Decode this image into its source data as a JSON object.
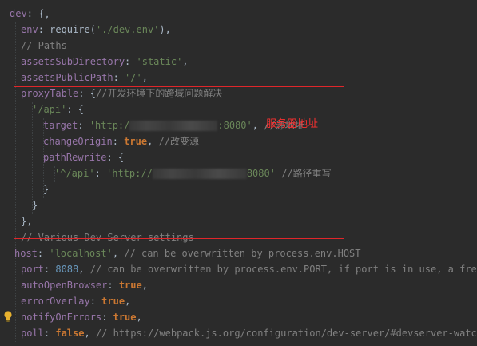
{
  "code": {
    "line_top_partial": "",
    "line_dev_key": "dev",
    "line_dev_rest": ": {",
    "env_key": "env",
    "env_sep": ": require(",
    "env_val": "'./dev.env'",
    "env_end": "),",
    "paths_comment": "// Paths",
    "assets_sub_key": "assetsSubDirectory",
    "assets_sub_val": "'static'",
    "assets_pub_key": "assetsPublicPath",
    "assets_pub_val": "'/'",
    "proxy_key": "proxyTable",
    "proxy_sep": ": {",
    "proxy_comment": "//开发环境下的跨域问题解决",
    "api_key": "'/api'",
    "api_sep": ": {",
    "target_key": "target",
    "target_prefix": "'http:/",
    "target_suffix": ":8080'",
    "target_comma": ",",
    "target_comment": "//源地址",
    "change_key": "changeOrigin",
    "change_val": "true",
    "change_comment": "//改变源",
    "rewrite_key": "pathRewrite",
    "rewrite_sep": ": {",
    "rewrite_pattern": "'^/api'",
    "rewrite_prefix": "'http://",
    "rewrite_suffix": "8080'",
    "rewrite_comment": "//路径重写",
    "close_brace": "}",
    "close_brace_comma": "},",
    "various_comment": "// Various Dev Server settings",
    "host_key": "host",
    "host_val": "'localhost'",
    "host_comment": "// can be overwritten by process.env.HOST",
    "port_key": "port",
    "port_val": "8088",
    "port_comment": "// can be overwritten by process.env.PORT, if port is in use, a free o",
    "auto_key": "autoOpenBrowser",
    "auto_val": "true",
    "overlay_key": "errorOverlay",
    "overlay_val": "true",
    "notify_key": "notifyOnErrors",
    "notify_val": "true",
    "poll_key": "poll",
    "poll_val": "false",
    "poll_comment": "// https://webpack.js.org/configuration/dev-server/#devserver-watcho"
  },
  "annotation": {
    "text": "服务器地址"
  },
  "colors": {
    "background": "#2b2b2b",
    "property": "#9876aa",
    "string": "#6a8759",
    "keyword": "#cc7832",
    "number": "#6897bb",
    "comment": "#808080",
    "highlight_border": "#e0262a",
    "annotation": "#ff3030"
  },
  "icons": {
    "gutter": "lightbulb-icon"
  }
}
